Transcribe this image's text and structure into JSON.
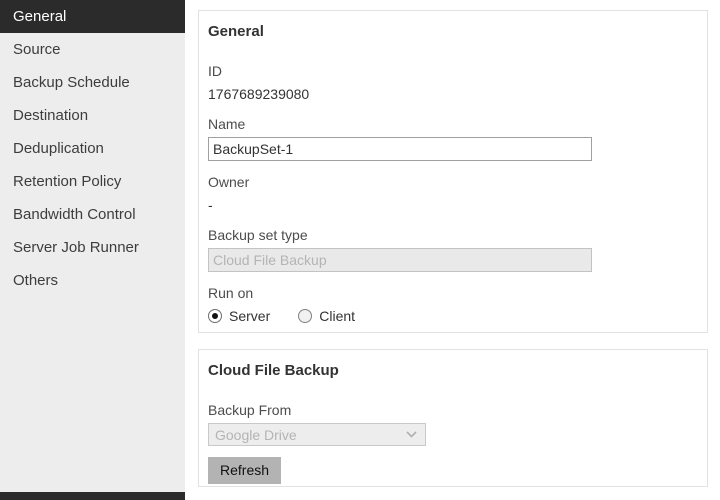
{
  "sidebar": {
    "items": [
      {
        "label": "General",
        "selected": true
      },
      {
        "label": "Source",
        "selected": false
      },
      {
        "label": "Backup Schedule",
        "selected": false
      },
      {
        "label": "Destination",
        "selected": false
      },
      {
        "label": "Deduplication",
        "selected": false
      },
      {
        "label": "Retention Policy",
        "selected": false
      },
      {
        "label": "Bandwidth Control",
        "selected": false
      },
      {
        "label": "Server Job Runner",
        "selected": false
      },
      {
        "label": "Others",
        "selected": false
      }
    ]
  },
  "panels": {
    "general": {
      "title": "General",
      "id_label": "ID",
      "id_value": "1767689239080",
      "name_label": "Name",
      "name_value": "BackupSet-1",
      "owner_label": "Owner",
      "owner_value": "-",
      "type_label": "Backup set type",
      "type_value": "Cloud File Backup",
      "run_on": {
        "label": "Run on",
        "options": [
          {
            "label": "Server",
            "selected": true
          },
          {
            "label": "Client",
            "selected": false
          }
        ]
      }
    },
    "cloud": {
      "title": "Cloud File Backup",
      "backup_from_label": "Backup From",
      "backup_from_value": "Google Drive",
      "refresh_label": "Refresh"
    }
  },
  "colors": {
    "sidebar_bg": "#ededed",
    "sidebar_selected_bg": "#2b2b2b",
    "sidebar_selected_text": "#ffffff",
    "panel_border": "#e2e2e2",
    "disabled_field_bg": "#e9e9e9",
    "disabled_field_text": "#b4b4b4",
    "button_bg": "#b3b3b3"
  }
}
